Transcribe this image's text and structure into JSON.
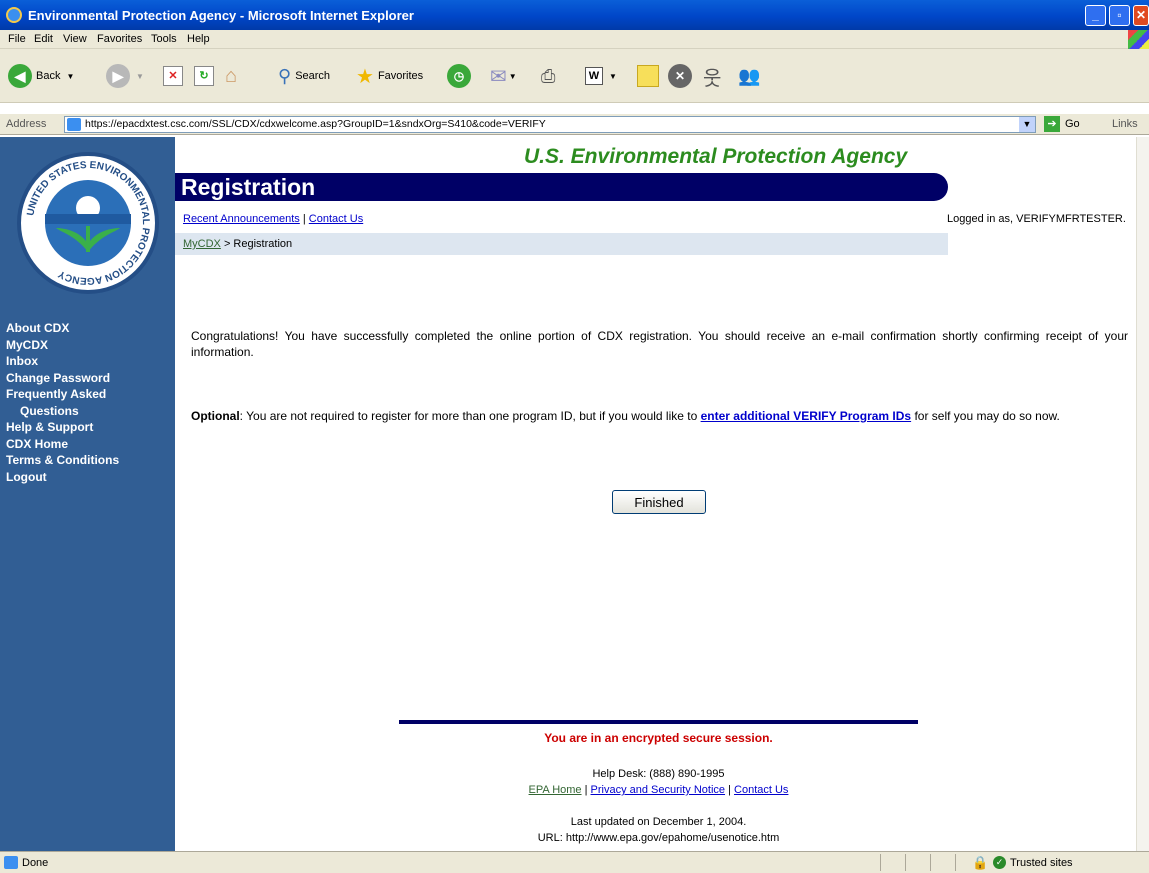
{
  "window": {
    "title": "Environmental Protection Agency - Microsoft Internet Explorer"
  },
  "menu": [
    "File",
    "Edit",
    "View",
    "Favorites",
    "Tools",
    "Help"
  ],
  "toolbar": {
    "back": "Back",
    "search": "Search",
    "favorites": "Favorites"
  },
  "address": {
    "label": "Address",
    "url": "https://epacdxtest.csc.com/SSL/CDX/cdxwelcome.asp?GroupID=1&sndxOrg=S410&code=VERIFY",
    "go": "Go",
    "links": "Links"
  },
  "seal": {
    "text": "UNITED STATES ENVIRONMENTAL PROTECTION AGENCY"
  },
  "sidebar": {
    "items": [
      "About CDX",
      "MyCDX",
      "Inbox",
      "Change Password",
      "Frequently Asked",
      "Questions",
      "Help & Support",
      "CDX Home",
      "Terms & Conditions",
      "Logout"
    ]
  },
  "header": {
    "agency": "U.S. Environmental Protection Agency",
    "page_title": "Registration",
    "recent_announcements": "Recent Announcements",
    "contact_us": "Contact Us",
    "logged_in": "Logged in as, VERIFYMFRTESTER."
  },
  "breadcrumb": {
    "home": "MyCDX",
    "current": "> Registration"
  },
  "main": {
    "congrats": "Congratulations! You have successfully completed the online portion of CDX registration. You should receive an e-mail confirmation shortly confirming receipt of your information.",
    "optional_label": "Optional",
    "optional_text_1": ": You are not required to register for more than one program ID, but if you would like to",
    "optional_link": "enter additional VERIFY Program IDs",
    "optional_text_2": "for self you may do so now.",
    "finished": "Finished"
  },
  "footer": {
    "secure": "You are in an encrypted secure session.",
    "helpdesk": "Help Desk: (888) 890-1995",
    "epa_home": "EPA Home",
    "privacy": "Privacy and Security Notice",
    "contact": "Contact Us",
    "updated": "Last updated on December 1, 2004.",
    "url": "URL: http://www.epa.gov/epahome/usenotice.htm"
  },
  "status": {
    "done": "Done",
    "zone": "Trusted sites"
  }
}
